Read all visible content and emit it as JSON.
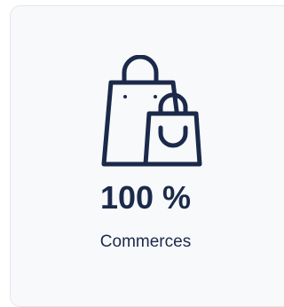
{
  "stat": {
    "icon": "shopping-bags-icon",
    "value": "100 %",
    "label": "Commerces"
  },
  "colors": {
    "text": "#1b2a4a",
    "icon": "#1b2a4a",
    "card_background": "#f8f9fa",
    "card_border": "#e4e6ea"
  }
}
